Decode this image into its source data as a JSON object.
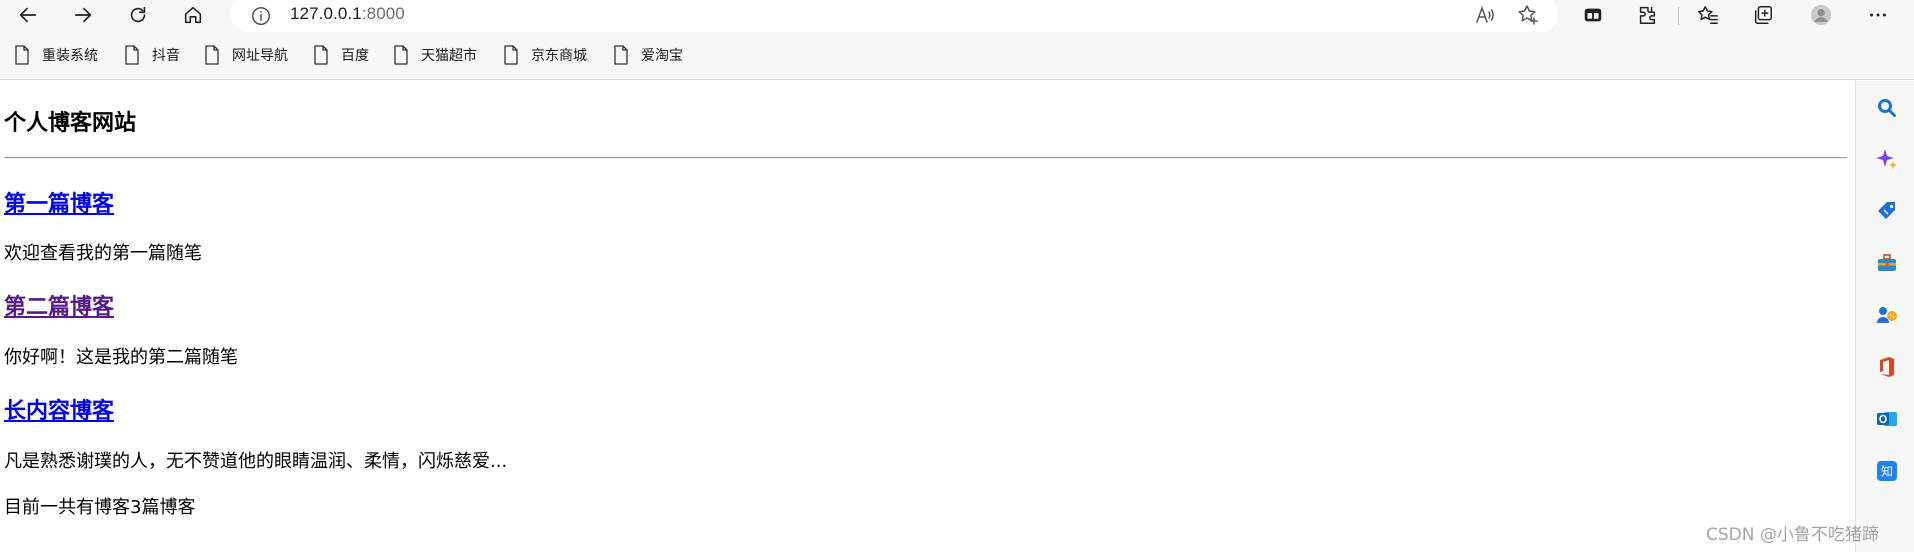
{
  "browser": {
    "url_host": "127.0.0.1",
    "url_port": ":8000",
    "nav_icons": [
      "back-icon",
      "forward-icon",
      "refresh-icon",
      "home-icon"
    ],
    "address_icons": [
      "read-aloud-icon",
      "add-favorite-icon"
    ],
    "toolbar_icons": [
      "split-screen-icon",
      "extensions-icon",
      "favorites-icon",
      "collections-icon",
      "profile-icon",
      "more-icon"
    ]
  },
  "bookmarks": [
    {
      "label": "重装系统"
    },
    {
      "label": "抖音"
    },
    {
      "label": "网址导航"
    },
    {
      "label": "百度"
    },
    {
      "label": "天猫超市"
    },
    {
      "label": "京东商城"
    },
    {
      "label": "爱淘宝"
    }
  ],
  "page": {
    "title": "个人博客网站",
    "posts": [
      {
        "title": "第一篇博客",
        "summary": "欢迎查看我的第一篇随笔",
        "visited": false
      },
      {
        "title": "第二篇博客",
        "summary": "你好啊！这是我的第二篇随笔",
        "visited": true
      },
      {
        "title": "长内容博客",
        "summary": "凡是熟悉谢璞的人，无不赞道他的眼睛温润、柔情，闪烁慈爱...",
        "visited": false
      }
    ],
    "count_text": "目前一共有博客3篇博客"
  },
  "sidebar": {
    "icons": [
      "search-icon",
      "copilot-icon",
      "shopping-icon",
      "tools-icon",
      "games-icon",
      "office-icon",
      "outlook-icon",
      "zhihu-icon"
    ]
  },
  "watermark": "CSDN @小鲁不吃猪蹄",
  "colors": {
    "link_unvisited": "#0000ee",
    "link_visited": "#551a8b",
    "chrome_bg": "#f7f7f7"
  }
}
